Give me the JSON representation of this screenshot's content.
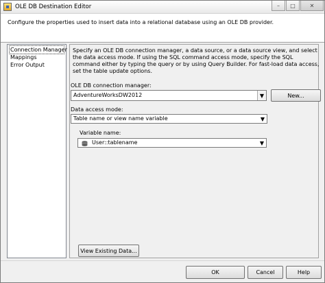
{
  "window": {
    "title": "OLE DB Destination Editor",
    "minimize_glyph": "–",
    "maximize_glyph": "□",
    "close_glyph": "✕"
  },
  "description": "Configure the properties used to insert data into a relational database using an OLE DB provider.",
  "nav": {
    "items": [
      {
        "label": "Connection Manager",
        "selected": true
      },
      {
        "label": "Mappings",
        "selected": false
      },
      {
        "label": "Error Output",
        "selected": false
      }
    ]
  },
  "content": {
    "info": "Specify an OLE DB connection manager, a data source, or a data source view, and select the data access mode. If using the SQL command access mode, specify the SQL command either by typing the query or by using Query Builder. For fast-load data access, set the table update options.",
    "connection_label": "OLE DB connection manager:",
    "connection_value": "AdventureWorksDW2012",
    "new_button": "New...",
    "access_mode_label": "Data access mode:",
    "access_mode_value": "Table name or view name variable",
    "variable_label": "Variable name:",
    "variable_value": "User::tablename",
    "view_button": "View Existing Data..."
  },
  "footer": {
    "ok": "OK",
    "cancel": "Cancel",
    "help": "Help"
  },
  "icons": {
    "app": "ssis-component-icon",
    "variable": "database-variable-icon"
  }
}
